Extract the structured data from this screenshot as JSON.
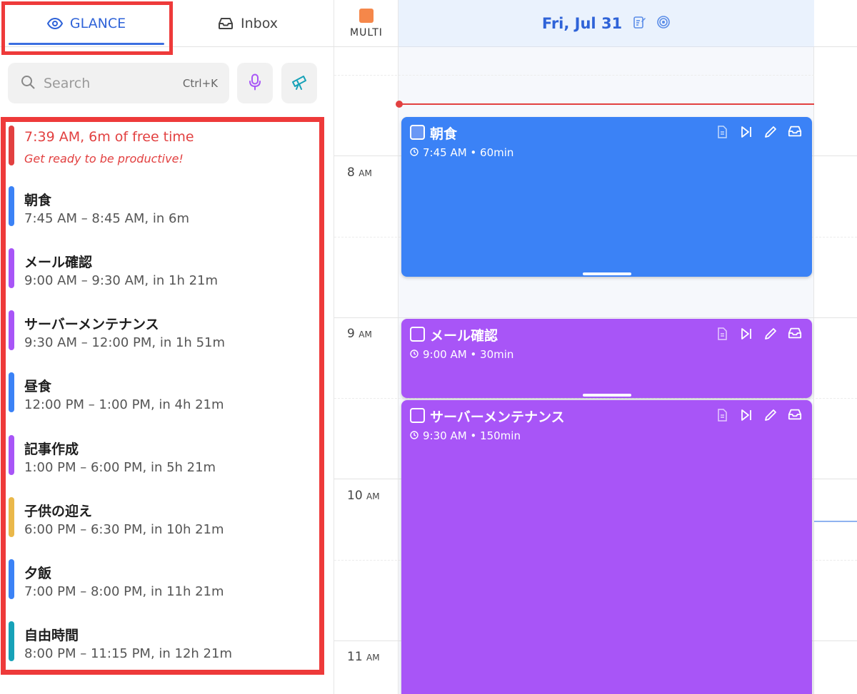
{
  "tabs": {
    "glance": "GLANCE",
    "inbox": "Inbox"
  },
  "search": {
    "placeholder": "Search",
    "shortcut": "Ctrl+K"
  },
  "glance_list": [
    {
      "title": "7:39 AM, 6m of free time",
      "subtitle": "Get ready to be productive!",
      "color": "#e24040"
    },
    {
      "title": "朝食",
      "subtitle": "7:45 AM – 8:45 AM, in 6m",
      "color": "#3b82f6"
    },
    {
      "title": "メール確認",
      "subtitle": "9:00 AM – 9:30 AM, in 1h 21m",
      "color": "#a855f7"
    },
    {
      "title": "サーバーメンテナンス",
      "subtitle": "9:30 AM – 12:00 PM, in 1h 51m",
      "color": "#a855f7"
    },
    {
      "title": "昼食",
      "subtitle": "12:00 PM – 1:00 PM, in 4h 21m",
      "color": "#3b82f6"
    },
    {
      "title": "記事作成",
      "subtitle": "1:00 PM – 6:00 PM, in 5h 21m",
      "color": "#a855f7"
    },
    {
      "title": "子供の迎え",
      "subtitle": "6:00 PM – 6:30 PM, in 10h 21m",
      "color": "#eab84a"
    },
    {
      "title": "夕飯",
      "subtitle": "7:00 PM – 8:00 PM, in 11h 21m",
      "color": "#3b82f6"
    },
    {
      "title": "自由時間",
      "subtitle": "8:00 PM – 11:15 PM, in 12h 21m",
      "color": "#17a2b8"
    }
  ],
  "calendar": {
    "multi_label": "MULTI",
    "multi_color": "#f5874a",
    "date": "Fri, Jul 31",
    "hours": [
      {
        "num": "8",
        "ampm": "AM"
      },
      {
        "num": "9",
        "ampm": "AM"
      },
      {
        "num": "10",
        "ampm": "AM"
      },
      {
        "num": "11",
        "ampm": "AM"
      }
    ],
    "events": [
      {
        "title": "朝食",
        "time": "7:45 AM • 60min",
        "color": "#3b82f6"
      },
      {
        "title": "メール確認",
        "time": "9:00 AM • 30min",
        "color": "#a855f7"
      },
      {
        "title": "サーバーメンテナンス",
        "time": "9:30 AM • 150min",
        "color": "#a855f7"
      }
    ]
  },
  "icons": {
    "glance_tab": "eye-icon",
    "inbox_tab": "inbox-icon",
    "search": "search-icon",
    "mic": "microphone-icon",
    "telescope": "telescope-icon",
    "notes": "notes-icon",
    "target": "target-icon",
    "event_notes": "document-icon",
    "event_skip": "skip-forward-icon",
    "event_edit": "pencil-icon",
    "event_inbox": "inbox-icon",
    "time": "clock-icon"
  }
}
